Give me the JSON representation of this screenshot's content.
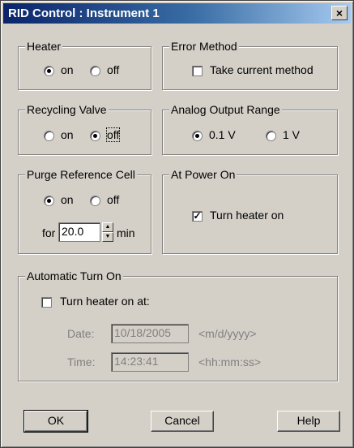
{
  "window": {
    "title": "RID Control : Instrument 1",
    "close_label": "×"
  },
  "heater": {
    "label": "Heater",
    "on": "on",
    "off": "off",
    "selected": "on"
  },
  "error_method": {
    "label": "Error Method",
    "take_current": "Take current method",
    "checked": false
  },
  "recycling_valve": {
    "label": "Recycling Valve",
    "on": "on",
    "off": "off",
    "selected": "off"
  },
  "analog_output": {
    "label": "Analog Output Range",
    "opt1": "0.1 V",
    "opt2": "1 V",
    "selected": "0.1 V"
  },
  "purge": {
    "label": "Purge Reference Cell",
    "on": "on",
    "off": "off",
    "selected": "on",
    "for_label": "for",
    "value": "20.0",
    "unit": "min"
  },
  "power_on": {
    "label": "At Power On",
    "turn_heater_on": "Turn heater on",
    "checked": true
  },
  "auto_turn_on": {
    "label": "Automatic Turn On",
    "checkbox_label": "Turn heater on at:",
    "checked": false,
    "date_label": "Date:",
    "date_value": "10/18/2005",
    "date_format": "<m/d/yyyy>",
    "time_label": "Time:",
    "time_value": "14:23:41",
    "time_format": "<hh:mm:ss>"
  },
  "buttons": {
    "ok": "OK",
    "cancel": "Cancel",
    "help": "Help"
  }
}
